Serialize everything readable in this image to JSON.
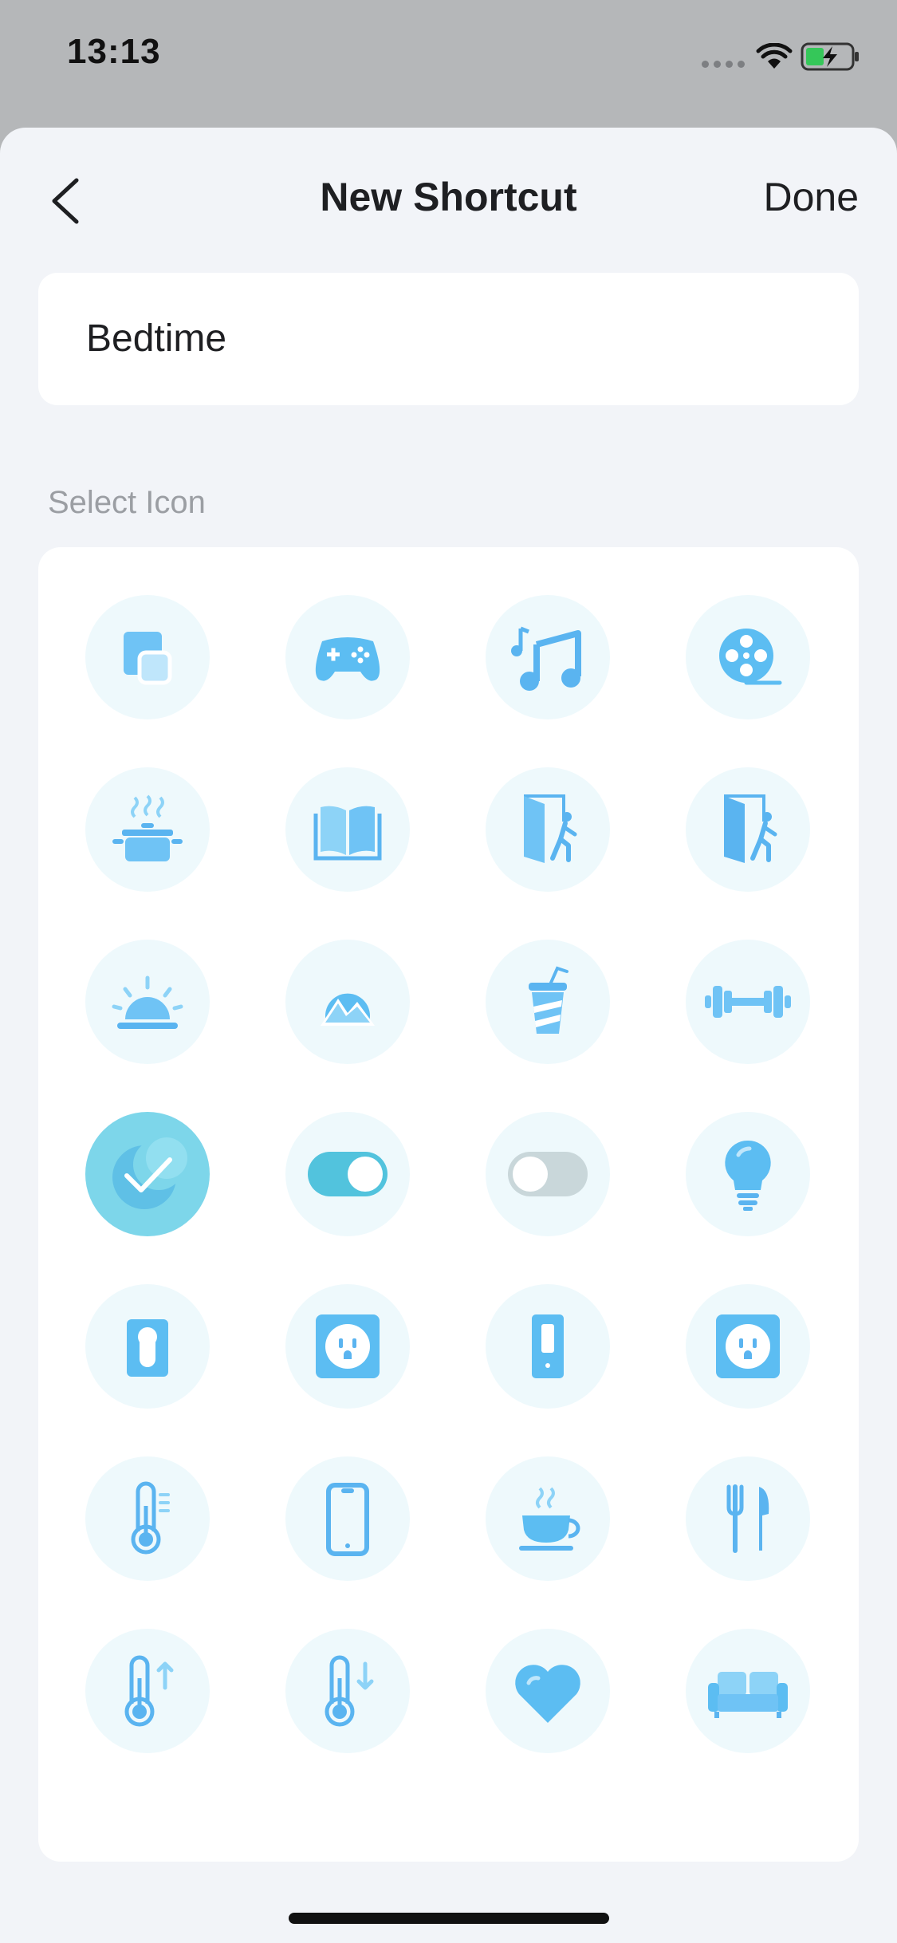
{
  "status_bar": {
    "time": "13:13"
  },
  "nav": {
    "title": "New Shortcut",
    "done_label": "Done"
  },
  "shortcut_name": "Bedtime",
  "section_label": "Select Icon",
  "selected_icon": "moon",
  "icons": [
    "widget",
    "gamepad",
    "music",
    "film-reel",
    "cooking-pot",
    "book",
    "door-enter",
    "door-exit",
    "sunrise",
    "mountain",
    "drink-cup",
    "dumbbell",
    "moon",
    "toggle-on",
    "toggle-off",
    "light-bulb",
    "light-switch",
    "outlet",
    "wall-switch",
    "outlet-square",
    "thermometer",
    "phone",
    "coffee-cup",
    "fork-knife",
    "temperature-up",
    "temperature-down",
    "heart",
    "sofa"
  ],
  "colors": {
    "accent": "#5ab4f0",
    "icon_light": "#8dd3f7",
    "cell_bg": "#eef9fc",
    "selected_bg": "#7dd6ea",
    "sheet_bg": "#f2f4f8"
  }
}
